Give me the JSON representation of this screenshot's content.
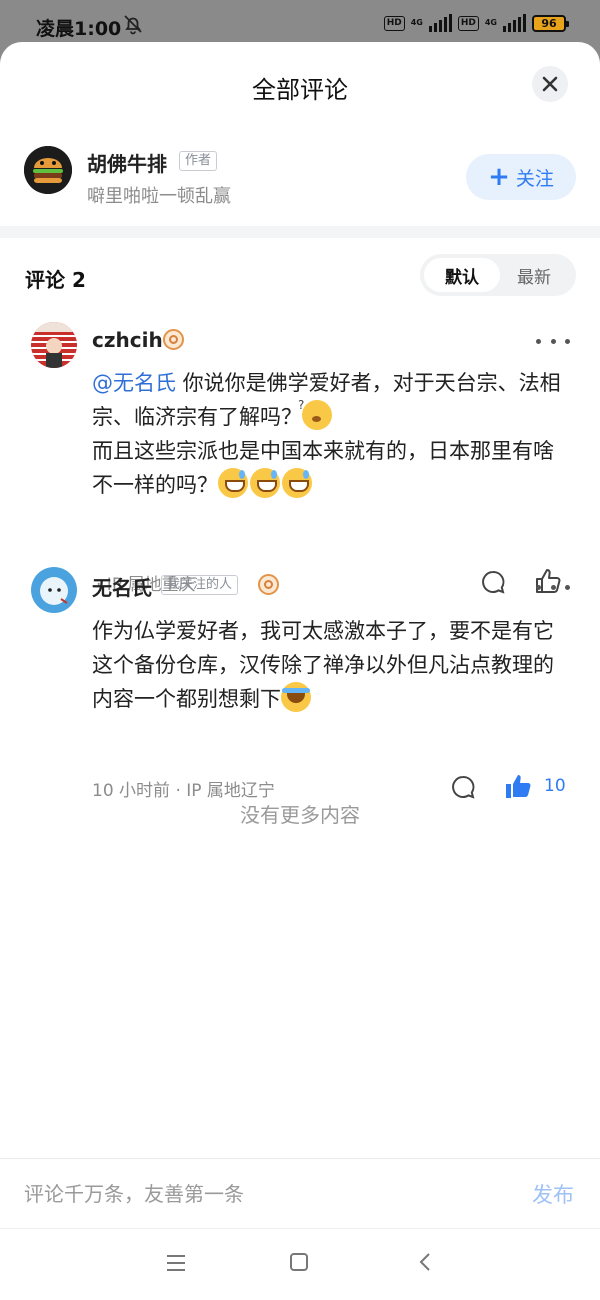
{
  "status_bar": {
    "time": "凌晨1:00",
    "hd1": "HD",
    "net1": "4G",
    "hd2": "HD",
    "net2": "4G",
    "battery": "96"
  },
  "sheet": {
    "title": "全部评论"
  },
  "author": {
    "name": "胡佛牛排",
    "badge": "作者",
    "subtitle": "噼里啪啦一顿乱赢",
    "follow_label": "关注",
    "follow_icon": "plus-icon"
  },
  "comments_header": {
    "count_label": "评论 2",
    "sort_default": "默认",
    "sort_latest": "最新"
  },
  "comments": [
    {
      "user": "czhcih",
      "level_icon": "level-badge-icon",
      "mention": "@无名氏",
      "text_1": " 你说你是佛学爱好者，对于天台宗、法相宗、临济宗有了解吗？",
      "text_2": "而且这些宗派也是中国本来就有的，日本那里有啥不一样的吗？",
      "meta": "· IP 属地重庆",
      "emojis": [
        "thinking-emoji",
        "sweat-smile-emoji",
        "sweat-smile-emoji",
        "sweat-smile-emoji"
      ]
    },
    {
      "user": "无名氏",
      "badge": "我关注的人",
      "level_icon": "level-badge-icon",
      "text": "作为仏学爱好者，我可太感激本子了，要不是有它这个备份仓库，汉传除了禅净以外但凡沾点教理的内容一个都别想剩下",
      "meta": "10 小时前 · IP 属地辽宁",
      "like_count": "10",
      "emojis": [
        "crying-laughing-emoji"
      ]
    }
  ],
  "footer_note": "没有更多内容",
  "input": {
    "placeholder": "评论千万条，友善第一条",
    "send_label": "发布"
  },
  "colors": {
    "accent": "#2f7bf3",
    "mention": "#2f6fd6",
    "send_disabled": "#9ec2f5"
  }
}
